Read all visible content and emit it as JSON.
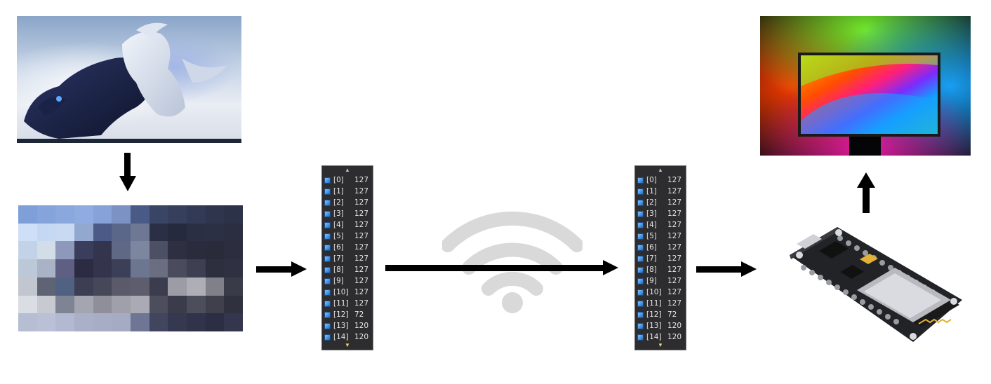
{
  "diagram": {
    "memory_panel_left": {
      "entries": [
        {
          "index": "[0]",
          "value": "127"
        },
        {
          "index": "[1]",
          "value": "127"
        },
        {
          "index": "[2]",
          "value": "127"
        },
        {
          "index": "[3]",
          "value": "127"
        },
        {
          "index": "[4]",
          "value": "127"
        },
        {
          "index": "[5]",
          "value": "127"
        },
        {
          "index": "[6]",
          "value": "127"
        },
        {
          "index": "[7]",
          "value": "127"
        },
        {
          "index": "[8]",
          "value": "127"
        },
        {
          "index": "[9]",
          "value": "127"
        },
        {
          "index": "[10]",
          "value": "127"
        },
        {
          "index": "[11]",
          "value": "127"
        },
        {
          "index": "[12]",
          "value": "72"
        },
        {
          "index": "[13]",
          "value": "120"
        },
        {
          "index": "[14]",
          "value": "120"
        }
      ]
    },
    "memory_panel_right": {
      "entries": [
        {
          "index": "[0]",
          "value": "127"
        },
        {
          "index": "[1]",
          "value": "127"
        },
        {
          "index": "[2]",
          "value": "127"
        },
        {
          "index": "[3]",
          "value": "127"
        },
        {
          "index": "[4]",
          "value": "127"
        },
        {
          "index": "[5]",
          "value": "127"
        },
        {
          "index": "[6]",
          "value": "127"
        },
        {
          "index": "[7]",
          "value": "127"
        },
        {
          "index": "[8]",
          "value": "127"
        },
        {
          "index": "[9]",
          "value": "127"
        },
        {
          "index": "[10]",
          "value": "127"
        },
        {
          "index": "[11]",
          "value": "127"
        },
        {
          "index": "[12]",
          "value": "72"
        },
        {
          "index": "[13]",
          "value": "120"
        },
        {
          "index": "[14]",
          "value": "120"
        }
      ]
    },
    "icons": {
      "wifi": "wifi-icon",
      "panel_scroll_up": "scroll-up-arrow-icon",
      "panel_scroll_down": "scroll-down-arrow-icon",
      "entry_marker": "cube-icon"
    },
    "colors": {
      "arrow": "#000000",
      "panel_background": "#2d2d30",
      "panel_text": "#e6e6e6",
      "wifi_gray": "#d9d9d9"
    },
    "pixel_grid_colors": [
      [
        "#7f9fd9",
        "#85a4dc",
        "#8aa8de",
        "#8fabe0",
        "#86a2d8",
        "#7c92c4",
        "#4a5a86",
        "#3a4566",
        "#363f5c",
        "#323a55",
        "#2e354d",
        "#2c3349"
      ],
      [
        "#cfdff7",
        "#c4d8f4",
        "#c7daf2",
        "#93a8cf",
        "#4b5a86",
        "#5a6788",
        "#6e7894",
        "#2b2f45",
        "#262a3d",
        "#2a2f43",
        "#2b3045",
        "#2a2e40"
      ],
      [
        "#c3d3e7",
        "#d3dde8",
        "#8d98bb",
        "#3b3d5c",
        "#33354f",
        "#5f6884",
        "#7c879f",
        "#4d5064",
        "#2e3042",
        "#2a2c3d",
        "#292b3b",
        "#2c2e3f"
      ],
      [
        "#bcc8d8",
        "#aab2c6",
        "#5e5f82",
        "#2c2b44",
        "#34344c",
        "#3b3f57",
        "#6d7690",
        "#6a6e80",
        "#4a4b5d",
        "#3e3f51",
        "#2d2e3e",
        "#2f3041"
      ],
      [
        "#c2c6cf",
        "#5f6474",
        "#516182",
        "#3c3f54",
        "#47475a",
        "#5a5a6b",
        "#5d5d6d",
        "#3b3c4d",
        "#9b9ca6",
        "#adaeb6",
        "#7f8089",
        "#3a3b49"
      ],
      [
        "#dadde3",
        "#c8cad2",
        "#7f8495",
        "#a3a6b0",
        "#8e8f98",
        "#9fa0aa",
        "#a9aab3",
        "#4d4e5d",
        "#3b3c4b",
        "#4d4e5b",
        "#3f404c",
        "#30313e"
      ],
      [
        "#b6bed3",
        "#bac1d6",
        "#b3b9d0",
        "#a9b0c8",
        "#a7adc5",
        "#a5abc3",
        "#6f7594",
        "#41455e",
        "#35384f",
        "#303349",
        "#2c2f44",
        "#33364c"
      ]
    ]
  }
}
